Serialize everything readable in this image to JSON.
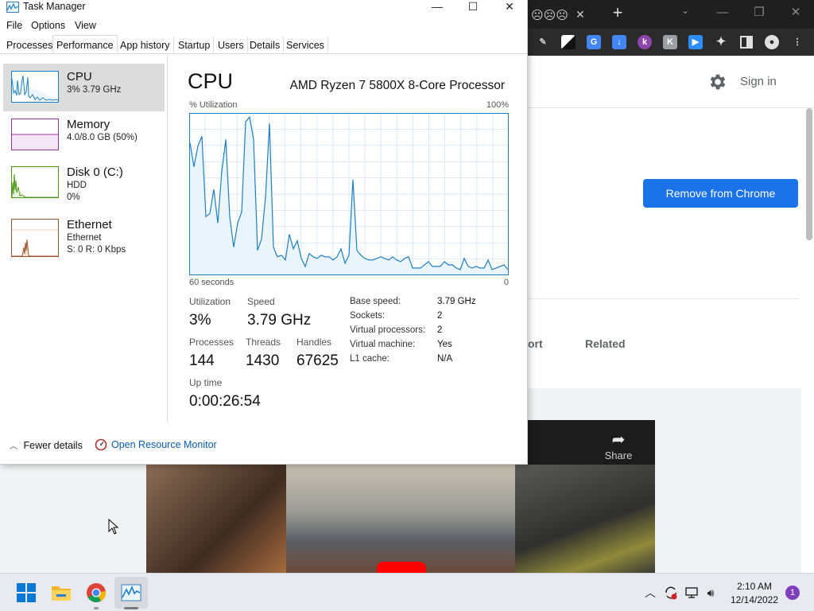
{
  "browser": {
    "tab_title": "☹☹☹",
    "new_tab_symbol": "+",
    "sign_in": "Sign in",
    "remove_button": "Remove from Chrome",
    "tabs": {
      "support_partial": "ort",
      "related": "Related"
    },
    "video_share": "Share",
    "extensions": [
      "pen-icon",
      "contrast-icon",
      "translate-icon",
      "download-icon",
      "k-icon",
      "ghost-icon",
      "zoom-icon",
      "puzzle-icon",
      "sidebar-icon",
      "profile-icon",
      "more-icon"
    ],
    "colors": {
      "primary_button": "#1a73e8",
      "tabstrip": "#1f1f1f"
    }
  },
  "task_manager": {
    "title": "Task Manager",
    "menu": [
      "File",
      "Options",
      "View"
    ],
    "tabs": [
      "Processes",
      "Performance",
      "App history",
      "Startup",
      "Users",
      "Details",
      "Services"
    ],
    "active_tab": "Performance",
    "sidebar": [
      {
        "name": "CPU",
        "sub1": "3%  3.79 GHz",
        "sub2": "",
        "sub3": "",
        "color": "#1f7fc0",
        "selected": true
      },
      {
        "name": "Memory",
        "sub1": "4.0/8.0 GB (50%)",
        "sub2": "",
        "sub3": "",
        "color": "#9c2f9c",
        "selected": false
      },
      {
        "name": "Disk 0 (C:)",
        "sub1": "HDD",
        "sub2": "0%",
        "sub3": "",
        "color": "#4d9a1a",
        "selected": false
      },
      {
        "name": "Ethernet",
        "sub1": "Ethernet",
        "sub2": "S: 0  R: 0 Kbps",
        "sub3": "",
        "color": "#a0522d",
        "selected": false
      }
    ],
    "main": {
      "heading": "CPU",
      "model": "AMD Ryzen 7 5800X 8-Core Processor",
      "util_label": "% Utilization",
      "util_max": "100%",
      "axis_left": "60 seconds",
      "axis_right": "0",
      "stats": {
        "utilization_label": "Utilization",
        "utilization": "3%",
        "speed_label": "Speed",
        "speed": "3.79 GHz",
        "processes_label": "Processes",
        "processes": "144",
        "threads_label": "Threads",
        "threads": "1430",
        "handles_label": "Handles",
        "handles": "67625",
        "uptime_label": "Up time",
        "uptime": "0:00:26:54"
      },
      "specs": [
        {
          "key": "Base speed:",
          "value": "3.79 GHz"
        },
        {
          "key": "Sockets:",
          "value": "2"
        },
        {
          "key": "Virtual processors:",
          "value": "2"
        },
        {
          "key": "Virtual machine:",
          "value": "Yes"
        },
        {
          "key": "L1 cache:",
          "value": "N/A"
        }
      ]
    },
    "footer": {
      "fewer_details": "Fewer details",
      "open_resource_monitor": "Open Resource Monitor"
    },
    "cpu_history": [
      82,
      67,
      80,
      86,
      36,
      38,
      53,
      32,
      64,
      84,
      36,
      17,
      32,
      39,
      95,
      98,
      84,
      15,
      22,
      48,
      94,
      17,
      11,
      12,
      9,
      25,
      16,
      21,
      10,
      5,
      13,
      11,
      10,
      12,
      11,
      11,
      9,
      11,
      16,
      7,
      12,
      59,
      15,
      12,
      10,
      9,
      9,
      10,
      11,
      10,
      9,
      11,
      9,
      8,
      10,
      11,
      4,
      4,
      4,
      6,
      8,
      5,
      5,
      5,
      8,
      6,
      6,
      4,
      3,
      10,
      5,
      4,
      5,
      4,
      4,
      9,
      3,
      4,
      5,
      6,
      3
    ]
  },
  "taskbar": {
    "apps": [
      "start-icon",
      "file-explorer-icon",
      "chrome-icon",
      "task-manager-icon"
    ],
    "time": "2:10 AM",
    "date": "12/14/2022",
    "notification_count": "1"
  }
}
